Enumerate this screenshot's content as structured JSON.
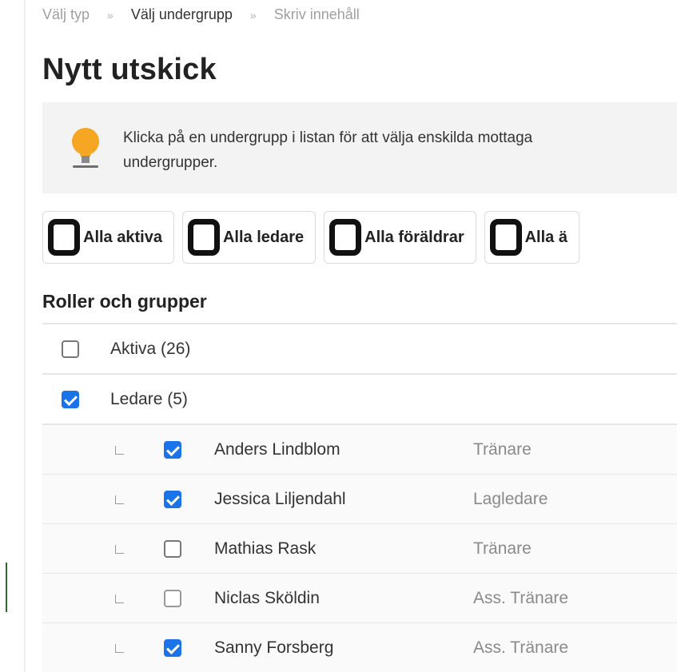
{
  "breadcrumb": {
    "step1": "Välj typ",
    "step2": "Välj undergrupp",
    "step3": "Skriv innehåll",
    "separator": "»"
  },
  "page_title": "Nytt utskick",
  "info": {
    "line1": "Klicka på en undergrupp i listan för att välja enskilda mottaga",
    "line2": "undergrupper.",
    "icon": "lightbulb-icon"
  },
  "quick_select": {
    "all_active": "Alla aktiva",
    "all_leaders": "Alla ledare",
    "all_parents": "Alla föräldrar",
    "all_other": "Alla ä"
  },
  "section_heading": "Roller och grupper",
  "groups": [
    {
      "label": "Aktiva (26)",
      "checked": false
    },
    {
      "label": "Ledare (5)",
      "checked": true
    }
  ],
  "members": [
    {
      "name": "Anders Lindblom",
      "role": "Tränare",
      "checked": true
    },
    {
      "name": "Jessica Liljendahl",
      "role": "Lagledare",
      "checked": true
    },
    {
      "name": "Mathias Rask",
      "role": "Tränare",
      "checked": false
    },
    {
      "name": "Niclas Sköldin",
      "role": "Ass. Tränare",
      "checked": false
    },
    {
      "name": "Sanny Forsberg",
      "role": "Ass. Tränare",
      "checked": true
    }
  ],
  "colors": {
    "checkbox_checked": "#1a73e8",
    "info_background": "#f3f3f3",
    "bulb": "#f5a623"
  }
}
